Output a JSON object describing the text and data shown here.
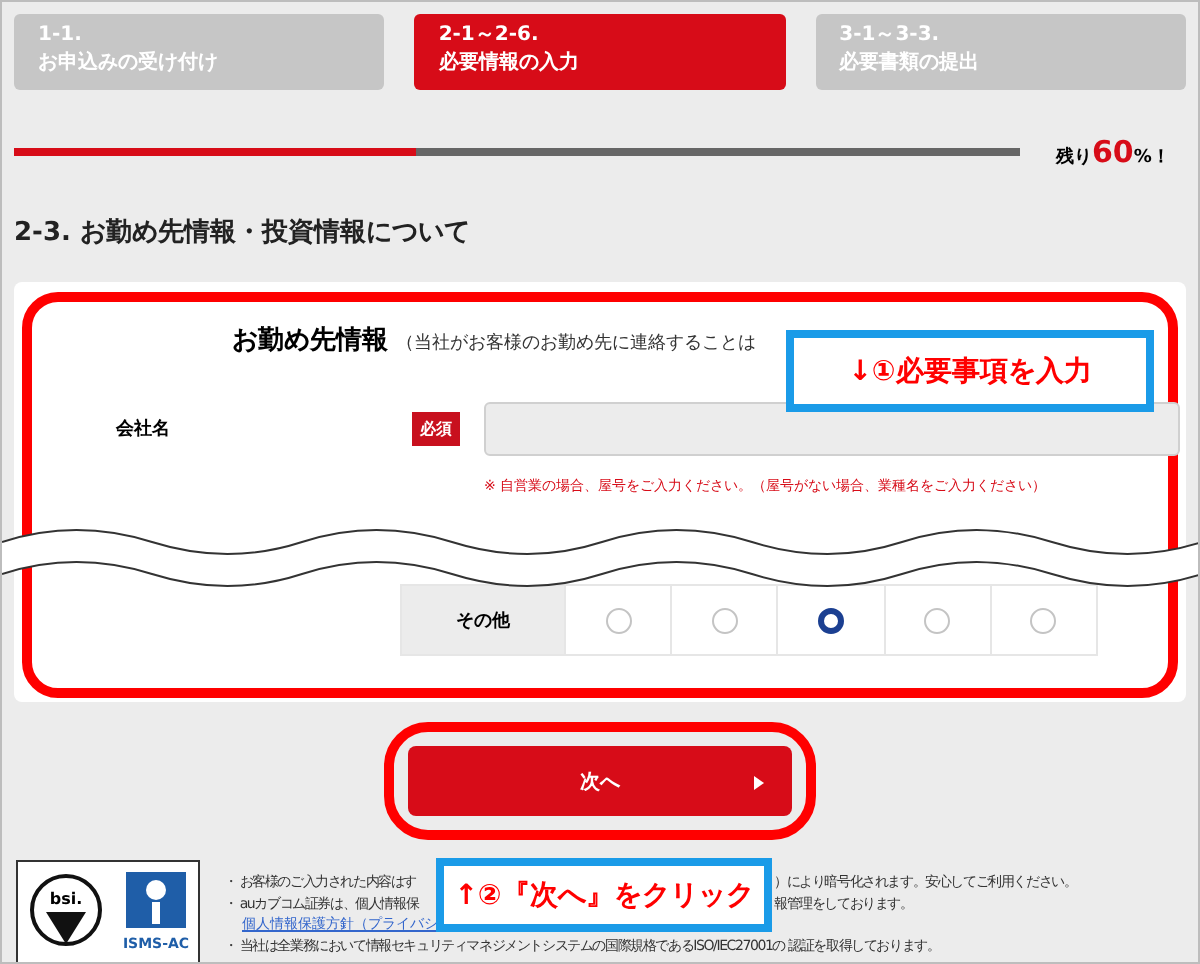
{
  "steps": [
    {
      "number": "1-1.",
      "label": "お申込みの受け付け",
      "selected": false
    },
    {
      "number": "2-1～2-6.",
      "label": "必要情報の入力",
      "selected": true
    },
    {
      "number": "3-1～3-3.",
      "label": "必要書類の提出",
      "selected": false
    }
  ],
  "progress": {
    "level": 0.4,
    "remaining": "残り**60**%！"
  },
  "section_title": "2-3. お勤め先情報・投資情報について",
  "form": {
    "title": "お勤め先情報",
    "title_note": "（当社がお客様のお勤め先に連絡することは",
    "field": {
      "label": "会社名",
      "required_badge": "必須",
      "note": "※ 自営業の場合、屋号をご入力ください。（屋号がない場合、業種名をご入力ください）"
    },
    "radio_row": {
      "label": "その他",
      "options": [
        {
          "selected": false
        },
        {
          "selected": false
        },
        {
          "selected": true
        },
        {
          "selected": false
        },
        {
          "selected": false
        }
      ]
    }
  },
  "next_button": {
    "label": "次へ"
  },
  "annotations": [
    "↓①必要事項を入力",
    "↑②『次へ』をクリック"
  ],
  "footer": {
    "logos": [
      "bsi.",
      "ISMS-AC"
    ],
    "notes": [
      {
        "kind": "split",
        "left": "・ お客様のご入力された内容はす",
        "right": "）により暗号化されます。安心してご利用ください。"
      },
      {
        "kind": "split",
        "left": "・ auカブコム証券は、個人情報保",
        "right": "報管理をしております。"
      },
      {
        "kind": "link",
        "left": "個人情報保護方針（プライバシ"
      },
      {
        "kind": "full",
        "left": "・ 当社は全業務において情報セキュリティマネジメントシステムの国際規格であるISO/IEC27001の 認証を取得しております。"
      }
    ]
  }
}
